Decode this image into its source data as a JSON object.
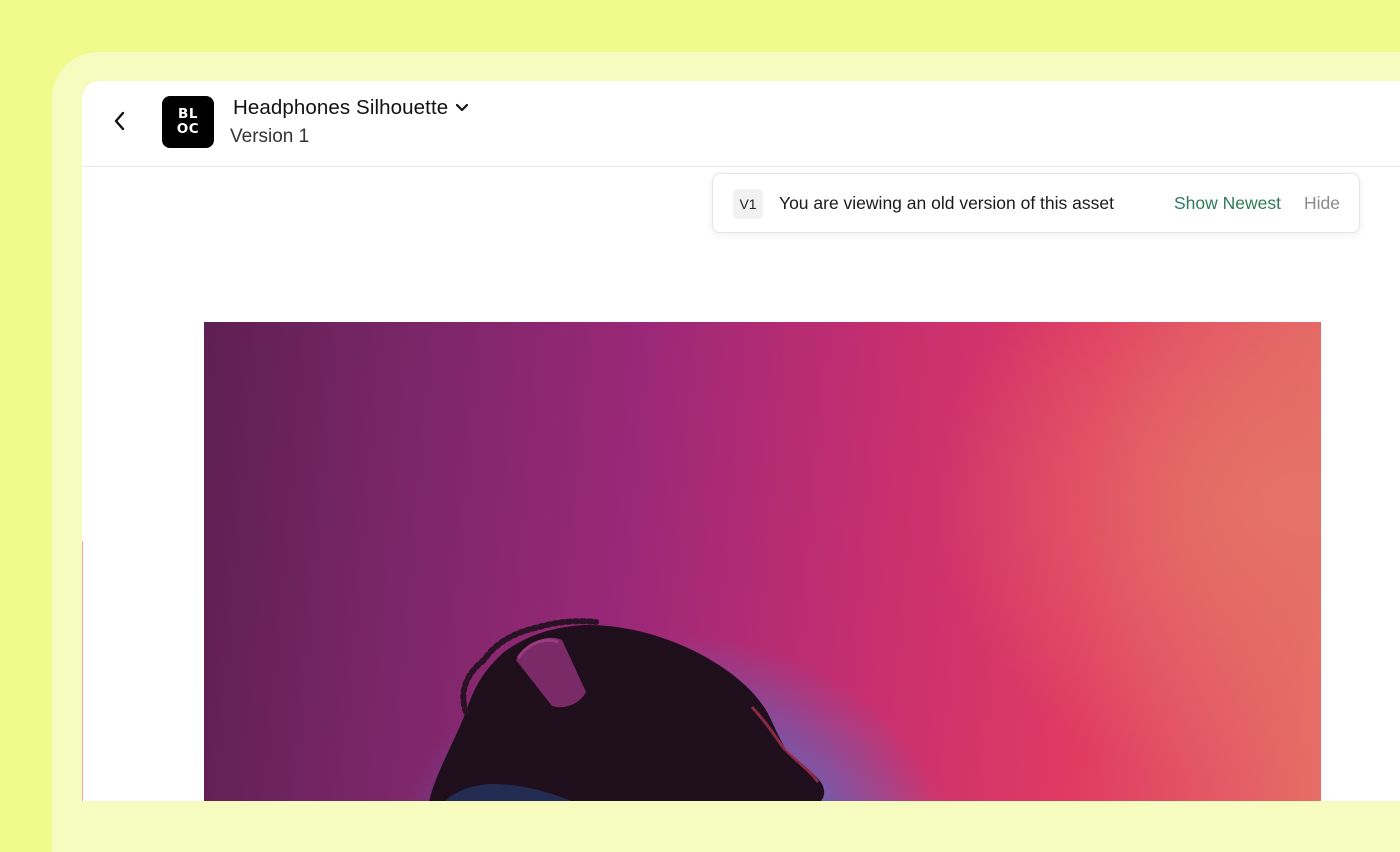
{
  "header": {
    "logo_line1": "BL",
    "logo_line2": "OC",
    "title": "Headphones Silhouette",
    "version": "Version 1"
  },
  "notice": {
    "badge": "V1",
    "message": "You are viewing an old version of this asset",
    "show_newest_label": "Show Newest",
    "hide_label": "Hide"
  },
  "icons": {
    "back": "chevron-left-icon",
    "title_dropdown": "chevron-down-icon"
  },
  "colors": {
    "page_background": "#f1fb8c",
    "frame": "#f6fcc0",
    "link_accent": "#2f7a5b",
    "hide_link": "#8a8a8a"
  }
}
